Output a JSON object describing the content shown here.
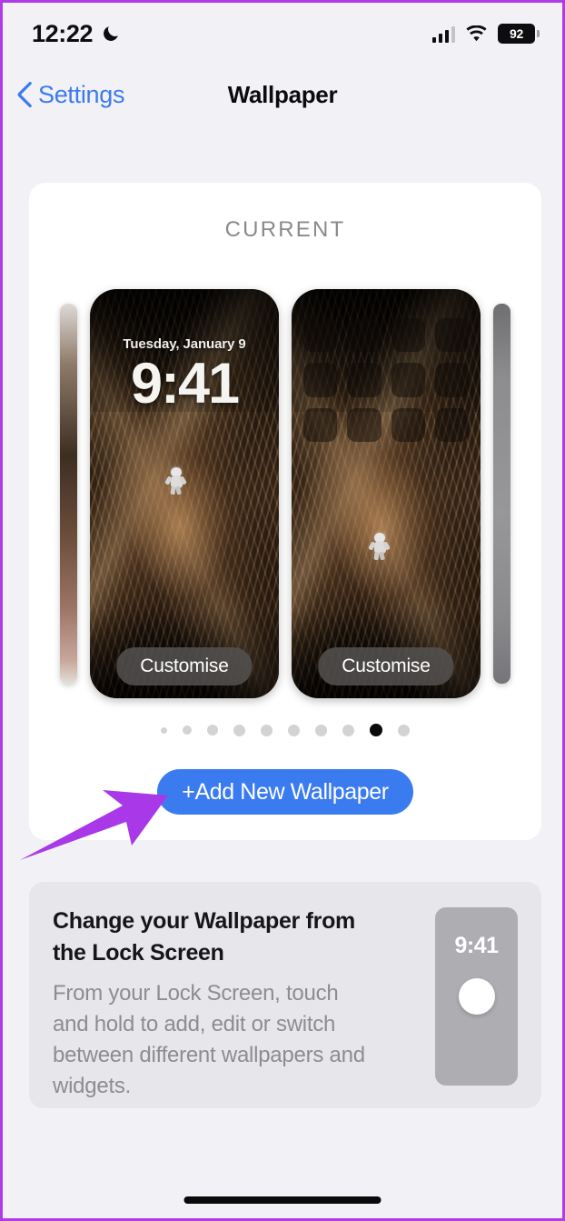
{
  "status_bar": {
    "time": "12:22",
    "dnd_icon": "crescent-moon-icon",
    "signal_icon": "cellular-signal-icon",
    "wifi_icon": "wifi-icon",
    "battery_percent": "92"
  },
  "nav": {
    "back_label": "Settings",
    "back_icon": "chevron-left-icon",
    "title": "Wallpaper"
  },
  "current_section": {
    "label": "CURRENT",
    "lock_preview": {
      "date": "Tuesday, January 9",
      "time": "9:41",
      "customise_label": "Customise"
    },
    "home_preview": {
      "customise_label": "Customise",
      "app_placeholder_count": 12
    },
    "page_dots": {
      "total": 10,
      "active_index": 8
    },
    "add_button_label": "+Add New Wallpaper"
  },
  "annotation": {
    "arrow_icon": "arrow-pointer-icon",
    "arrow_color": "#a838e8"
  },
  "info_card": {
    "title": "Change your Wallpaper from the Lock Screen",
    "body": "From your Lock Screen, touch and hold to add, edit or switch between different wallpapers and widgets.",
    "mini_phone_time": "9:41",
    "touch_indicator_icon": "touch-circle-icon"
  },
  "colors": {
    "accent_blue": "#3b7bf0",
    "page_bg": "#f2f1f6",
    "card_bg": "#ffffff",
    "info_card_bg": "#e7e6eb",
    "border_purple": "#b03ce8"
  },
  "home_indicator": "home-indicator-bar"
}
